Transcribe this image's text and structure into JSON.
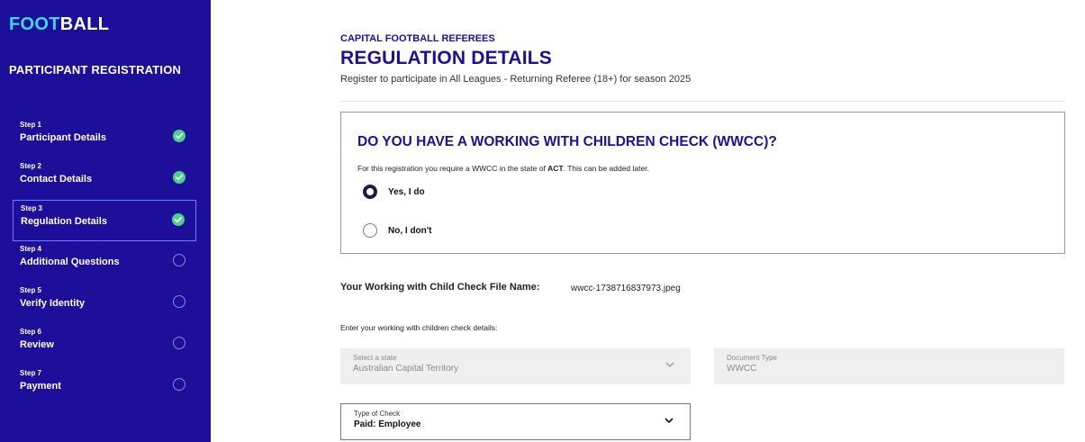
{
  "sidebar": {
    "brand_part1": "FOOT",
    "brand_part2": "BALL",
    "title": "PARTICIPANT REGISTRATION",
    "steps": [
      {
        "num": "Step 1",
        "name": "Participant Details",
        "status": "complete"
      },
      {
        "num": "Step 2",
        "name": "Contact Details",
        "status": "complete"
      },
      {
        "num": "Step 3",
        "name": "Regulation Details",
        "status": "complete"
      },
      {
        "num": "Step 4",
        "name": "Additional Questions",
        "status": "incomplete"
      },
      {
        "num": "Step 5",
        "name": "Verify Identity",
        "status": "incomplete"
      },
      {
        "num": "Step 6",
        "name": "Review",
        "status": "incomplete"
      },
      {
        "num": "Step 7",
        "name": "Payment",
        "status": "incomplete"
      }
    ]
  },
  "header": {
    "org": "CAPITAL FOOTBALL REFEREES",
    "title": "REGULATION DETAILS",
    "subtitle": "Register to participate in All Leagues - Returning Referee (18+) for season 2025"
  },
  "wwcc_card": {
    "title": "DO YOU HAVE A WORKING WITH CHILDREN CHECK (WWCC)?",
    "note_prefix": "For this registration you require a WWCC in the state of ",
    "note_state": "ACT",
    "note_suffix": ". This can be added later.",
    "option_yes": "Yes, I do",
    "option_no": "No, I don't",
    "selected": "yes"
  },
  "file": {
    "label": "Your Working with Child Check File Name:",
    "name": "wwcc-1738716837973.jpeg"
  },
  "details": {
    "note": "Enter your working with children check details:",
    "state_label": "Select a state",
    "state_value": "Australian Capital Territory",
    "doctype_label": "Document Type",
    "doctype_value": "WWCC",
    "check_label": "Type of Check",
    "check_value": "Paid: Employee"
  },
  "colors": {
    "sidebar_bg": "#1d0f9a",
    "brand_accent": "#3fd6e6",
    "complete_green": "#4cd08a",
    "heading_navy": "#1d0f9a"
  },
  "icons": {
    "complete": "check-circle-icon",
    "incomplete": "empty-circle-icon",
    "dropdown": "chevron-down-icon"
  }
}
